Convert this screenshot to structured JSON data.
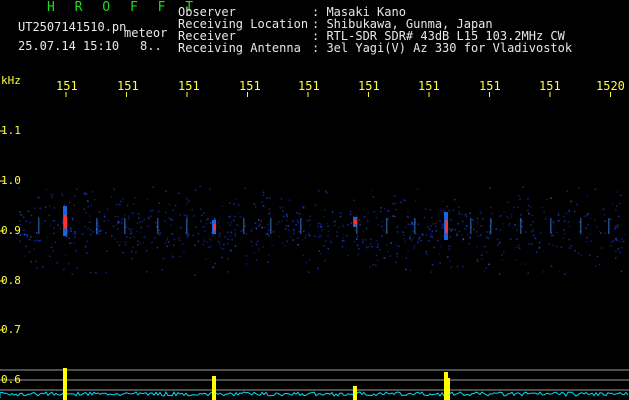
{
  "header": {
    "brand": "H R O F F T",
    "filename": "UT2507141510.pn",
    "extension": "meteor",
    "datetime": "25.07.14 15:10",
    "count": "8..",
    "fields": [
      {
        "label": "Observer",
        "value": ": Masaki Kano"
      },
      {
        "label": "Receiving Location",
        "value": ": Shibukawa, Gunma, Japan"
      },
      {
        "label": "Receiver",
        "value": ": RTL-SDR SDR# 43dB L15 103.2MHz CW"
      },
      {
        "label": "Receiving Antenna",
        "value": ": 3el Yagi(V) Az 330 for Vladivostok"
      }
    ]
  },
  "axis": {
    "y_unit": "kHz",
    "x_ticks": [
      "151",
      "151",
      "151",
      "151",
      "151",
      "151",
      "151",
      "151",
      "151",
      "1520"
    ],
    "y_ticks": [
      "1.1",
      "1.0",
      "0.9",
      "0.8",
      "0.7",
      "0.6"
    ]
  },
  "colors": {
    "background": "#000000",
    "title_green": "#18e01a",
    "text_white": "#e8e8e8",
    "tick_yellow": "#ffff3a",
    "echo_red": "#ff3030",
    "noise_blue": "#1830b0",
    "meteor_bar": "#ffff00",
    "noise_line": "#00e0ff"
  }
}
